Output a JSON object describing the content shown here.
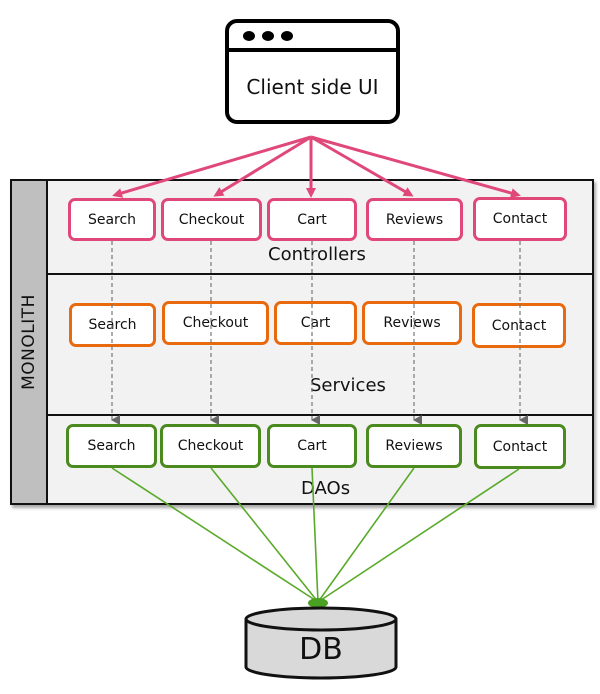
{
  "client": {
    "label": "Client side UI",
    "icon": "browser-window-icon"
  },
  "monolith": {
    "label": "MONOLITH"
  },
  "layers": {
    "controllers": {
      "label": "Controllers",
      "items": [
        "Search",
        "Checkout",
        "Cart",
        "Reviews",
        "Contact"
      ],
      "color": "#e0487a"
    },
    "services": {
      "label": "Services",
      "items": [
        "Search",
        "Checkout",
        "Cart",
        "Reviews",
        "Contact"
      ],
      "color": "#e8690e"
    },
    "daos": {
      "label": "DAOs",
      "items": [
        "Search",
        "Checkout",
        "Cart",
        "Reviews",
        "Contact"
      ],
      "color": "#4a8a1f"
    }
  },
  "database": {
    "label": "DB",
    "icon": "database-cylinder-icon"
  },
  "colors": {
    "client_arrows": "#e0487a",
    "db_links": "#5aaa2a",
    "flow_arrows": "#666666"
  }
}
